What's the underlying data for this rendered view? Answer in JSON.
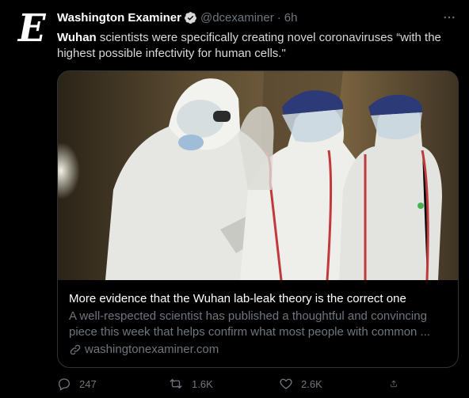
{
  "tweet": {
    "author_name": "Washington Examiner",
    "handle": "@dcexaminer",
    "separator": "·",
    "time": "6h",
    "avatar_letter": "E",
    "text_bold": "Wuhan",
    "text_rest": " scientists were specifically creating novel coronaviruses “with the highest possible infectivity for human cells.\""
  },
  "card": {
    "title": "More evidence that the Wuhan lab-leak theory is the correct one",
    "description": "A well-respected scientist has published a thoughtful and convincing piece this week that helps confirm what most people with common ...",
    "domain": "washingtonexaminer.com"
  },
  "actions": {
    "replies": "247",
    "retweets": "1.6K",
    "likes": "2.6K"
  },
  "icons": {
    "verified": "verified-badge-icon",
    "more": "more-icon",
    "link": "link-icon",
    "reply": "reply-icon",
    "retweet": "retweet-icon",
    "like": "like-icon",
    "share": "share-icon"
  },
  "colors": {
    "background": "#000000",
    "text": "#d9d9d9",
    "muted": "#6e767d",
    "border": "#2f3336"
  }
}
